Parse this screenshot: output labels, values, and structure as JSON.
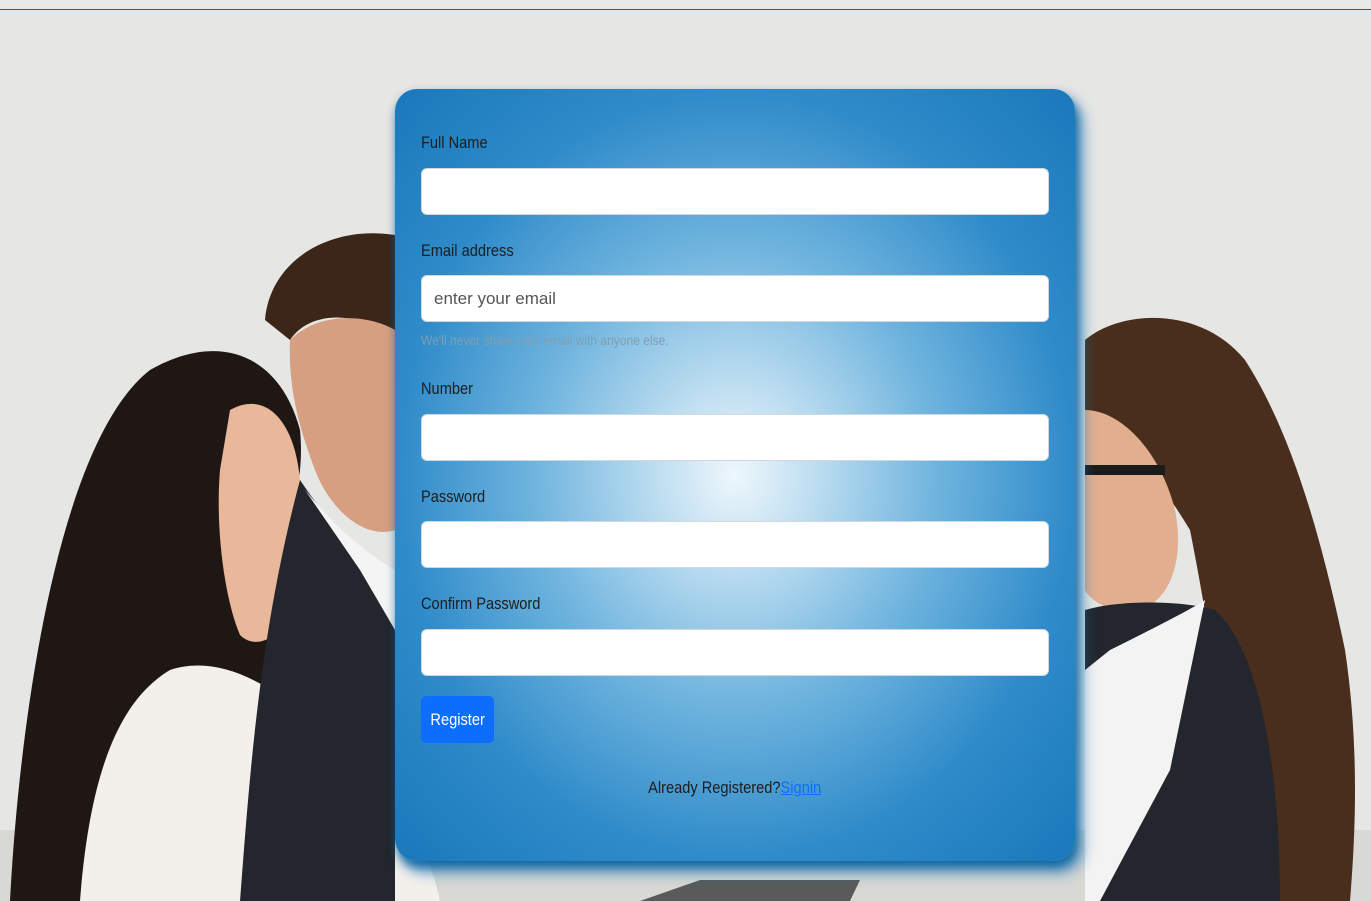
{
  "form": {
    "full_name": {
      "label": "Full Name",
      "value": "",
      "placeholder": ""
    },
    "email": {
      "label": "Email address",
      "value": "",
      "placeholder": "enter your email",
      "help": "We'll never share your email with anyone else."
    },
    "number": {
      "label": "Number",
      "value": "",
      "placeholder": ""
    },
    "password": {
      "label": "Password",
      "value": "",
      "placeholder": ""
    },
    "confirm_password": {
      "label": "Confirm Password",
      "value": "",
      "placeholder": ""
    },
    "register_label": "Register",
    "signin_prompt": "Already Registered?",
    "signin_link": "Signin"
  },
  "colors": {
    "primary": "#0d6efd",
    "card_edge": "#1a78bb",
    "card_center": "#eef7fb"
  }
}
